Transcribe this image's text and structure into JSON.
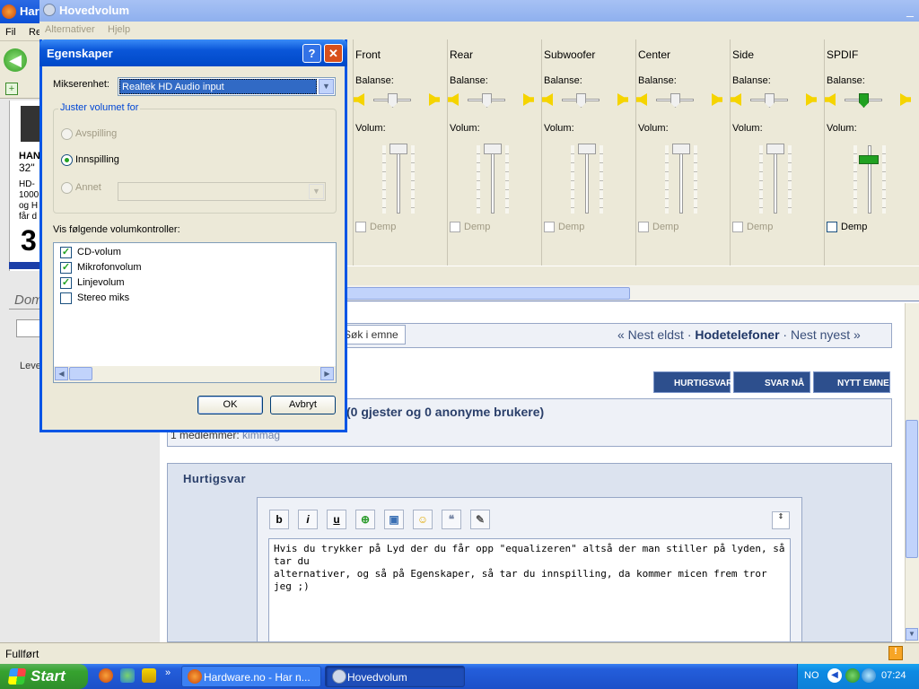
{
  "browser": {
    "title": "Har",
    "menu": [
      "Fil",
      "Re"
    ],
    "ad": {
      "head_top": "HAN",
      "size": "32\"",
      "lines": [
        "HD-",
        "1000",
        "og H",
        "får d"
      ],
      "big": "3"
    },
    "sidebar": {
      "domain_label": "Dom",
      "lev_label": "Leve"
    },
    "nav": {
      "search_topic": "Søk i emne",
      "prev_oldest": "« Nest eldst",
      "sep1": "·",
      "current": "Hodetelefoner",
      "sep2": "·",
      "next_newest": "Nest nyest »"
    },
    "actions": {
      "quick_reply": "HURTIGSVAR",
      "reply_now": "SVAR NÅ",
      "new_topic": "NYTT EMNE"
    },
    "users": {
      "heading": "(0 gjester og 0 anonyme brukere)",
      "members_label": "1 medlemmer:",
      "member_name": "kimmag"
    },
    "quick_reply": {
      "heading": "Hurtigsvar",
      "toolbar": {
        "bold": "b",
        "italic": "i",
        "underline": "u"
      },
      "text": "Hvis du trykker på Lyd der du får opp \"equalizeren\" altså der man stiller på lyden, så tar du\nalternativer, og så på Egenskaper, så tar du innspilling, da kommer micen frem tror jeg ;)"
    },
    "status": "Fullført"
  },
  "volume_window": {
    "title": "Hovedvolum",
    "menu": [
      "Alternativer",
      "Hjelp"
    ],
    "balance_label": "Balanse:",
    "volume_label": "Volum:",
    "mute_label": "Demp",
    "columns": [
      {
        "name": "Front",
        "enabled": false,
        "balance": 0.5,
        "volume": 1.0
      },
      {
        "name": "Rear",
        "enabled": false,
        "balance": 0.5,
        "volume": 1.0
      },
      {
        "name": "Subwoofer",
        "enabled": false,
        "balance": 0.5,
        "volume": 1.0
      },
      {
        "name": "Center",
        "enabled": false,
        "balance": 0.5,
        "volume": 1.0
      },
      {
        "name": "Side",
        "enabled": false,
        "balance": 0.5,
        "volume": 1.0
      },
      {
        "name": "SPDIF",
        "enabled": true,
        "balance": 0.5,
        "volume": 0.8
      }
    ]
  },
  "dialog": {
    "title": "Egenskaper",
    "help_symbol": "?",
    "close_symbol": "✕",
    "mixer_label": "Mikserenhet:",
    "mixer_value": "Realtek HD Audio input",
    "group_label": "Juster volumet for",
    "radio": [
      {
        "label": "Avspilling",
        "selected": false,
        "enabled": false
      },
      {
        "label": "Innspilling",
        "selected": true,
        "enabled": true
      },
      {
        "label": "Annet",
        "selected": false,
        "enabled": false
      }
    ],
    "show_label": "Vis følgende volumkontroller:",
    "controls": [
      {
        "label": "CD-volum",
        "checked": true
      },
      {
        "label": "Mikrofonvolum",
        "checked": true
      },
      {
        "label": "Linjevolum",
        "checked": true
      },
      {
        "label": "Stereo miks",
        "checked": false
      }
    ],
    "ok": "OK",
    "cancel": "Avbryt"
  },
  "taskbar": {
    "start": "Start",
    "items": [
      {
        "label": "Hardware.no - Har n...",
        "active": false
      },
      {
        "label": "Hovedvolum",
        "active": true
      }
    ],
    "language": "NO",
    "clock": "07:24"
  },
  "colors": {
    "xp_blue": "#0a4fd6",
    "slider_green": "#21a121",
    "speaker_yellow": "#f5d400",
    "tray": "#0e8ae3"
  }
}
